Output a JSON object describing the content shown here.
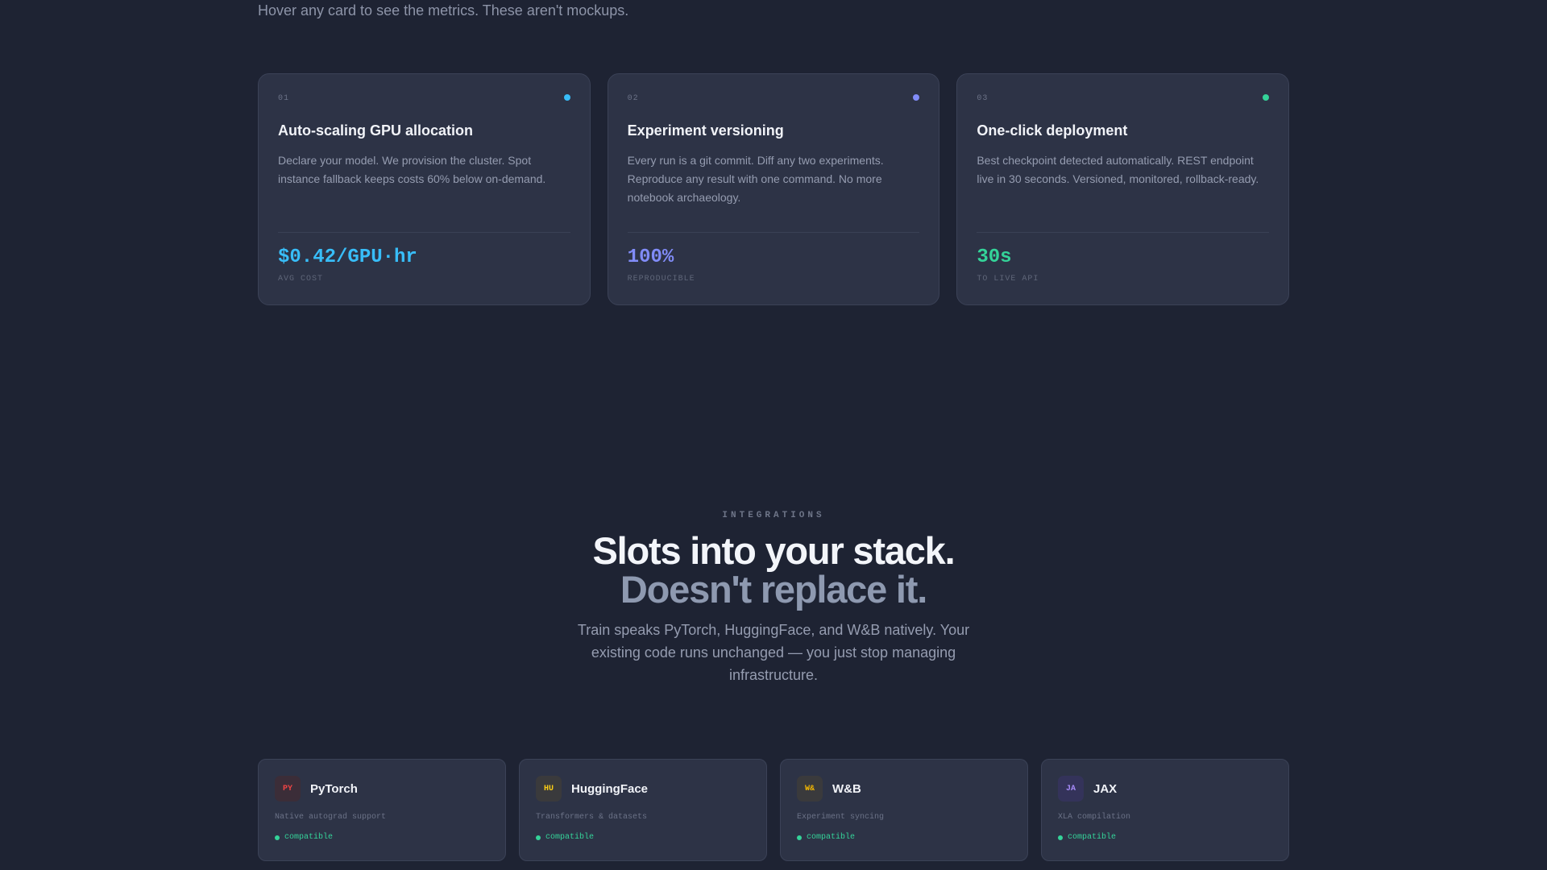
{
  "hero": {
    "subtitle": "Hover any card to see the metrics. These aren't mockups."
  },
  "features": [
    {
      "num": "01",
      "title": "Auto-scaling GPU allocation",
      "desc": "Declare your model. We provision the cluster. Spot instance fallback keeps costs 60% below on-demand.",
      "metric": "$0.42/GPU·hr",
      "metric_label": "AVG COST",
      "accent": "#38bdf8"
    },
    {
      "num": "02",
      "title": "Experiment versioning",
      "desc": "Every run is a git commit. Diff any two experiments. Reproduce any result with one command. No more notebook archaeology.",
      "metric": "100%",
      "metric_label": "REPRODUCIBLE",
      "accent": "#818cf8"
    },
    {
      "num": "03",
      "title": "One-click deployment",
      "desc": "Best checkpoint detected automatically. REST endpoint live in 30 seconds. Versioned, monitored, rollback-ready.",
      "metric": "30s",
      "metric_label": "TO LIVE API",
      "accent": "#34d399"
    }
  ],
  "integrations": {
    "eyebrow": "INTEGRATIONS",
    "title_line1": "Slots into your stack.",
    "title_line2": "Doesn't replace it.",
    "desc": "Train speaks PyTorch, HuggingFace, and W&B natively. Your existing code runs unchanged — you just stop managing infrastructure.",
    "items": [
      {
        "badge": "PY",
        "name": "PyTorch",
        "desc": "Native autograd support",
        "status": "compatible",
        "badge_color": "#ef4444",
        "badge_bg": "#3b2d38"
      },
      {
        "badge": "HU",
        "name": "HuggingFace",
        "desc": "Transformers & datasets",
        "status": "compatible",
        "badge_color": "#facc15",
        "badge_bg": "#3a3a3c"
      },
      {
        "badge": "W&",
        "name": "W&B",
        "desc": "Experiment syncing",
        "status": "compatible",
        "badge_color": "#f5b800",
        "badge_bg": "#3a3a3c"
      },
      {
        "badge": "JA",
        "name": "JAX",
        "desc": "XLA compilation",
        "status": "compatible",
        "badge_color": "#a78bfa",
        "badge_bg": "#34335a"
      }
    ]
  }
}
